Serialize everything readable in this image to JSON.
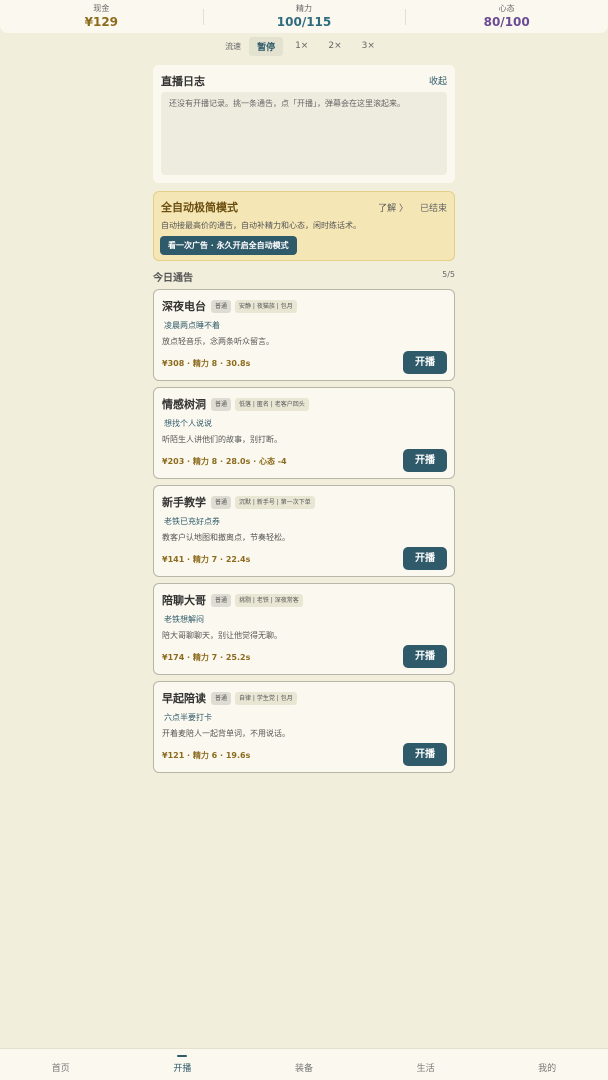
{
  "stats": {
    "cash_label": "现金",
    "cash_value": "¥129",
    "energy_label": "精力",
    "energy_value": "100/115",
    "mood_label": "心态",
    "mood_value": "80/100"
  },
  "speed": {
    "label": "流速",
    "options": [
      "暂停",
      "1×",
      "2×",
      "3×"
    ],
    "selected": "暂停"
  },
  "live_log": {
    "title": "直播日志",
    "collapse": "收起",
    "empty_text": "还没有开播记录。挑一条通告，点「开播」，弹幕会在这里滚起来。"
  },
  "auto_mode": {
    "title": "全自动极简模式",
    "learn_more": "了解 〉",
    "status": "已结束",
    "description": "自动接最高价的通告，自动补精力和心态，闲时练话术。",
    "button": "看一次广告 · 永久开启全自动模式"
  },
  "notices": {
    "title": "今日通告",
    "count": "5/5",
    "go_label": "开播",
    "items": [
      {
        "name": "深夜电台",
        "level": "普通",
        "traits": "安静 | 夜猫族 | 包月",
        "sub": "凌晨两点睡不着",
        "desc": "放点轻音乐，念两条听众留言。",
        "stats": "¥308 · 精力 8 · 30.8s"
      },
      {
        "name": "情感树洞",
        "level": "普通",
        "traits": "低落 | 匿名 | 老客户回头",
        "sub": "想找个人说说",
        "desc": "听陌生人讲他们的故事，别打断。",
        "stats": "¥203 · 精力 8 · 28.0s · 心态 -4"
      },
      {
        "name": "新手教学",
        "level": "普通",
        "traits": "沉默 | 新手号 | 第一次下单",
        "sub": "老铁已充好点券",
        "desc": "教客户认地图和撤离点，节奏轻松。",
        "stats": "¥141 · 精力 7 · 22.4s"
      },
      {
        "name": "陪聊大哥",
        "level": "普通",
        "traits": "挑剔 | 老铁 | 深夜常客",
        "sub": "老铁想解闷",
        "desc": "陪大哥聊聊天，别让他觉得无聊。",
        "stats": "¥174 · 精力 7 · 25.2s"
      },
      {
        "name": "早起陪读",
        "level": "普通",
        "traits": "自律 | 学生党 | 包月",
        "sub": "六点半要打卡",
        "desc": "开着麦陪人一起背单词，不用说话。",
        "stats": "¥121 · 精力 6 · 19.6s"
      }
    ]
  },
  "nav": {
    "items": [
      "首页",
      "开播",
      "装备",
      "生活",
      "我的"
    ],
    "active": "开播"
  }
}
